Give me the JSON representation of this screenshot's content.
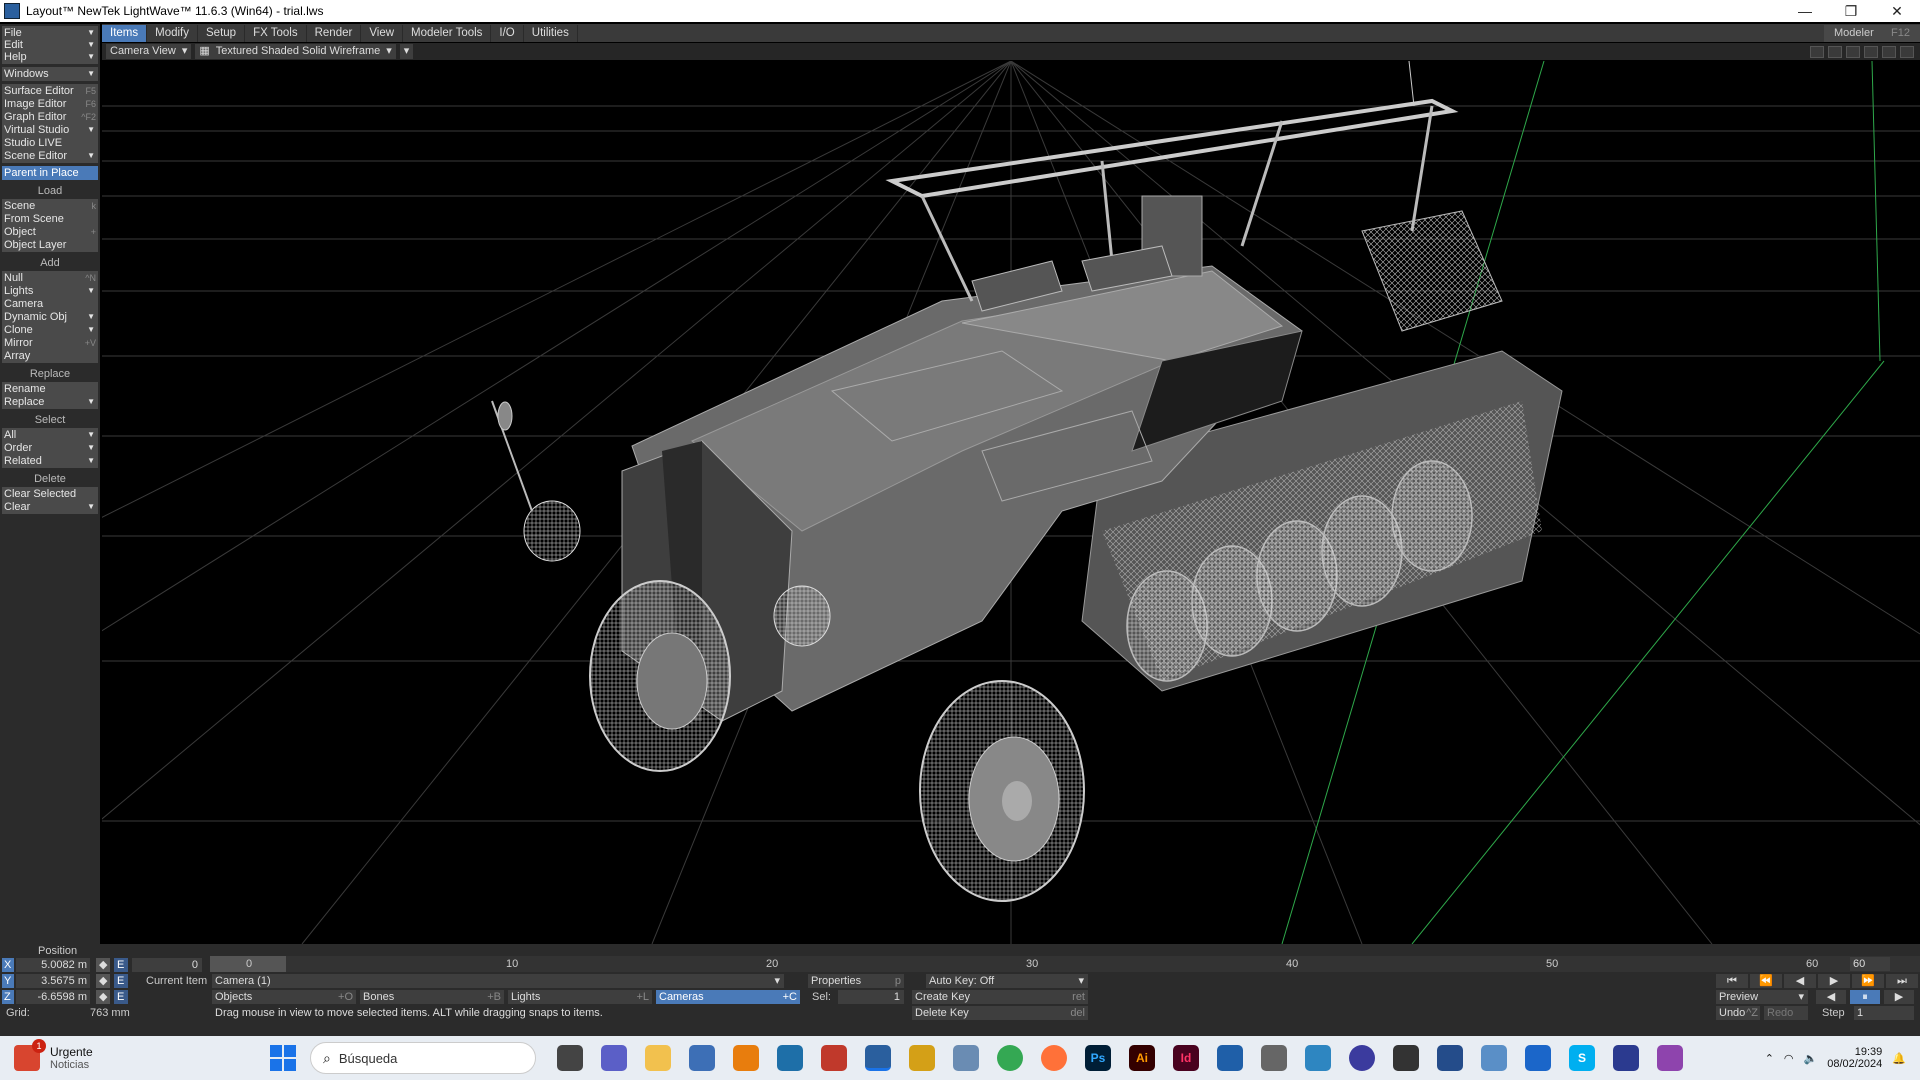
{
  "window": {
    "title": "Layout™ NewTek LightWave™ 11.6.3 (Win64) - trial.lws",
    "minimize": "—",
    "maximize": "❐",
    "close": "✕"
  },
  "menu_tabs": [
    "Items",
    "Modify",
    "Setup",
    "FX Tools",
    "Render",
    "View",
    "Modeler Tools",
    "I/O",
    "Utilities"
  ],
  "modeler": {
    "label": "Modeler",
    "shortcut": "F12"
  },
  "left_panel": {
    "top": [
      {
        "label": "File",
        "arrow": true
      },
      {
        "label": "Edit",
        "arrow": true
      },
      {
        "label": "Help",
        "arrow": true
      },
      {
        "label": "Windows",
        "arrow": true
      },
      {
        "label": "Surface Editor",
        "shortcut": "F5"
      },
      {
        "label": "Image Editor",
        "shortcut": "F6"
      },
      {
        "label": "Graph Editor",
        "shortcut": "^F2"
      },
      {
        "label": "Virtual Studio",
        "arrow": true
      },
      {
        "label": "Studio LIVE"
      },
      {
        "label": "Scene Editor",
        "arrow": true
      },
      {
        "label": "Parent in Place",
        "highlight": true
      }
    ],
    "sections": {
      "load": "Load",
      "add": "Add",
      "replace": "Replace",
      "select": "Select",
      "delete": "Delete"
    },
    "load": [
      {
        "label": "Scene",
        "shortcut": "k"
      },
      {
        "label": "From Scene"
      },
      {
        "label": "Object",
        "shortcut": "+"
      },
      {
        "label": "Object Layer"
      }
    ],
    "add": [
      {
        "label": "Null",
        "shortcut": "^N"
      },
      {
        "label": "Lights",
        "arrow": true
      },
      {
        "label": "Camera"
      },
      {
        "label": "Dynamic Obj",
        "arrow": true
      },
      {
        "label": "Clone",
        "arrow": true
      },
      {
        "label": "Mirror",
        "shortcut": "+V"
      },
      {
        "label": "Array"
      }
    ],
    "replace": [
      {
        "label": "Rename"
      },
      {
        "label": "Replace",
        "arrow": true
      }
    ],
    "select": [
      {
        "label": "All",
        "arrow": true
      },
      {
        "label": "Order",
        "arrow": true
      },
      {
        "label": "Related",
        "arrow": true
      }
    ],
    "delete": [
      {
        "label": "Clear Selected"
      },
      {
        "label": "Clear",
        "arrow": true
      }
    ]
  },
  "viewport_header": {
    "view": "Camera View",
    "mode": "Textured Shaded Solid Wireframe"
  },
  "timeline": {
    "ticks": [
      "0",
      "10",
      "20",
      "30",
      "40",
      "50",
      "60"
    ],
    "current_frame": "0",
    "end_frame": "60"
  },
  "position": {
    "label": "Position",
    "x": {
      "axis": "X",
      "value": "5.0082 m"
    },
    "y": {
      "axis": "Y",
      "value": "3.5675 m"
    },
    "z": {
      "axis": "Z",
      "value": "-6.6598 m"
    },
    "frame": "0",
    "grid_label": "Grid:",
    "grid_value": "763 mm"
  },
  "current_item": {
    "label": "Current Item",
    "value": "Camera (1)"
  },
  "properties": {
    "label": "Properties",
    "shortcut": "p"
  },
  "auto_key": "Auto Key: Off",
  "filters": [
    {
      "label": "Objects",
      "shortcut": "+O"
    },
    {
      "label": "Bones",
      "shortcut": "+B"
    },
    {
      "label": "Lights",
      "shortcut": "+L"
    },
    {
      "label": "Cameras",
      "shortcut": "+C",
      "active": true
    }
  ],
  "sel": {
    "label": "Sel:",
    "value": "1"
  },
  "keys": {
    "create": "Create Key",
    "create_sc": "ret",
    "delete": "Delete Key",
    "delete_sc": "del"
  },
  "status": "Drag mouse in view to move selected items. ALT while dragging snaps to items.",
  "playback": {
    "preview": "Preview",
    "undo": "Undo",
    "undo_sc": "^Z",
    "redo": "Redo",
    "step_label": "Step",
    "step_value": "1"
  },
  "taskbar": {
    "news_title": "Urgente",
    "news_sub": "Noticias",
    "news_badge": "1",
    "search_placeholder": "Búsqueda",
    "time": "19:39",
    "date": "08/02/2024",
    "apps": [
      "Ps",
      "Ai",
      "Id",
      "S"
    ]
  },
  "colors": {
    "accent": "#4a7ab8",
    "panel": "#2b2b2b",
    "button": "#4a4a4a"
  }
}
